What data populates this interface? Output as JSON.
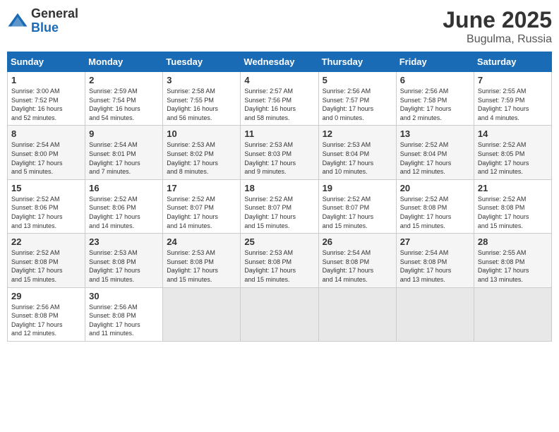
{
  "logo": {
    "general": "General",
    "blue": "Blue"
  },
  "title": "June 2025",
  "subtitle": "Bugulma, Russia",
  "days_header": [
    "Sunday",
    "Monday",
    "Tuesday",
    "Wednesday",
    "Thursday",
    "Friday",
    "Saturday"
  ],
  "weeks": [
    [
      {
        "day": "1",
        "info": "Sunrise: 3:00 AM\nSunset: 7:52 PM\nDaylight: 16 hours\nand 52 minutes."
      },
      {
        "day": "2",
        "info": "Sunrise: 2:59 AM\nSunset: 7:54 PM\nDaylight: 16 hours\nand 54 minutes."
      },
      {
        "day": "3",
        "info": "Sunrise: 2:58 AM\nSunset: 7:55 PM\nDaylight: 16 hours\nand 56 minutes."
      },
      {
        "day": "4",
        "info": "Sunrise: 2:57 AM\nSunset: 7:56 PM\nDaylight: 16 hours\nand 58 minutes."
      },
      {
        "day": "5",
        "info": "Sunrise: 2:56 AM\nSunset: 7:57 PM\nDaylight: 17 hours\nand 0 minutes."
      },
      {
        "day": "6",
        "info": "Sunrise: 2:56 AM\nSunset: 7:58 PM\nDaylight: 17 hours\nand 2 minutes."
      },
      {
        "day": "7",
        "info": "Sunrise: 2:55 AM\nSunset: 7:59 PM\nDaylight: 17 hours\nand 4 minutes."
      }
    ],
    [
      {
        "day": "8",
        "info": "Sunrise: 2:54 AM\nSunset: 8:00 PM\nDaylight: 17 hours\nand 5 minutes."
      },
      {
        "day": "9",
        "info": "Sunrise: 2:54 AM\nSunset: 8:01 PM\nDaylight: 17 hours\nand 7 minutes."
      },
      {
        "day": "10",
        "info": "Sunrise: 2:53 AM\nSunset: 8:02 PM\nDaylight: 17 hours\nand 8 minutes."
      },
      {
        "day": "11",
        "info": "Sunrise: 2:53 AM\nSunset: 8:03 PM\nDaylight: 17 hours\nand 9 minutes."
      },
      {
        "day": "12",
        "info": "Sunrise: 2:53 AM\nSunset: 8:04 PM\nDaylight: 17 hours\nand 10 minutes."
      },
      {
        "day": "13",
        "info": "Sunrise: 2:52 AM\nSunset: 8:04 PM\nDaylight: 17 hours\nand 12 minutes."
      },
      {
        "day": "14",
        "info": "Sunrise: 2:52 AM\nSunset: 8:05 PM\nDaylight: 17 hours\nand 12 minutes."
      }
    ],
    [
      {
        "day": "15",
        "info": "Sunrise: 2:52 AM\nSunset: 8:06 PM\nDaylight: 17 hours\nand 13 minutes."
      },
      {
        "day": "16",
        "info": "Sunrise: 2:52 AM\nSunset: 8:06 PM\nDaylight: 17 hours\nand 14 minutes."
      },
      {
        "day": "17",
        "info": "Sunrise: 2:52 AM\nSunset: 8:07 PM\nDaylight: 17 hours\nand 14 minutes."
      },
      {
        "day": "18",
        "info": "Sunrise: 2:52 AM\nSunset: 8:07 PM\nDaylight: 17 hours\nand 15 minutes."
      },
      {
        "day": "19",
        "info": "Sunrise: 2:52 AM\nSunset: 8:07 PM\nDaylight: 17 hours\nand 15 minutes."
      },
      {
        "day": "20",
        "info": "Sunrise: 2:52 AM\nSunset: 8:08 PM\nDaylight: 17 hours\nand 15 minutes."
      },
      {
        "day": "21",
        "info": "Sunrise: 2:52 AM\nSunset: 8:08 PM\nDaylight: 17 hours\nand 15 minutes."
      }
    ],
    [
      {
        "day": "22",
        "info": "Sunrise: 2:52 AM\nSunset: 8:08 PM\nDaylight: 17 hours\nand 15 minutes."
      },
      {
        "day": "23",
        "info": "Sunrise: 2:53 AM\nSunset: 8:08 PM\nDaylight: 17 hours\nand 15 minutes."
      },
      {
        "day": "24",
        "info": "Sunrise: 2:53 AM\nSunset: 8:08 PM\nDaylight: 17 hours\nand 15 minutes."
      },
      {
        "day": "25",
        "info": "Sunrise: 2:53 AM\nSunset: 8:08 PM\nDaylight: 17 hours\nand 15 minutes."
      },
      {
        "day": "26",
        "info": "Sunrise: 2:54 AM\nSunset: 8:08 PM\nDaylight: 17 hours\nand 14 minutes."
      },
      {
        "day": "27",
        "info": "Sunrise: 2:54 AM\nSunset: 8:08 PM\nDaylight: 17 hours\nand 13 minutes."
      },
      {
        "day": "28",
        "info": "Sunrise: 2:55 AM\nSunset: 8:08 PM\nDaylight: 17 hours\nand 13 minutes."
      }
    ],
    [
      {
        "day": "29",
        "info": "Sunrise: 2:56 AM\nSunset: 8:08 PM\nDaylight: 17 hours\nand 12 minutes."
      },
      {
        "day": "30",
        "info": "Sunrise: 2:56 AM\nSunset: 8:08 PM\nDaylight: 17 hours\nand 11 minutes."
      },
      {
        "day": "",
        "info": ""
      },
      {
        "day": "",
        "info": ""
      },
      {
        "day": "",
        "info": ""
      },
      {
        "day": "",
        "info": ""
      },
      {
        "day": "",
        "info": ""
      }
    ]
  ]
}
